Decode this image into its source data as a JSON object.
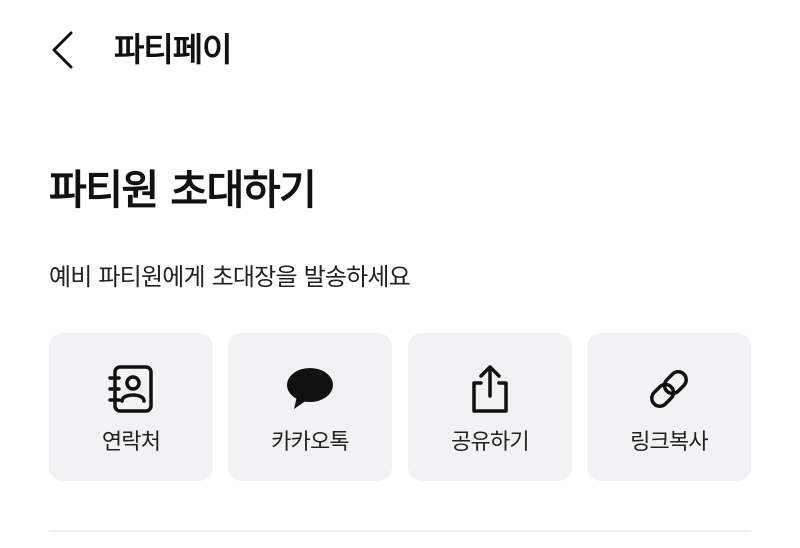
{
  "header": {
    "title": "파티페이"
  },
  "invite": {
    "title": "파티원 초대하기",
    "description": "예비 파티원에게 초대장을 발송하세요"
  },
  "share_options": [
    {
      "label": "연락처",
      "icon": "contacts-book-icon"
    },
    {
      "label": "카카오톡",
      "icon": "kakaotalk-speech-bubble-icon"
    },
    {
      "label": "공유하기",
      "icon": "share-upload-icon"
    },
    {
      "label": "링크복사",
      "icon": "link-chain-icon"
    }
  ],
  "colors": {
    "card_background": "#f2f2f4",
    "text_primary": "#111111",
    "divider": "#eeeeee"
  }
}
